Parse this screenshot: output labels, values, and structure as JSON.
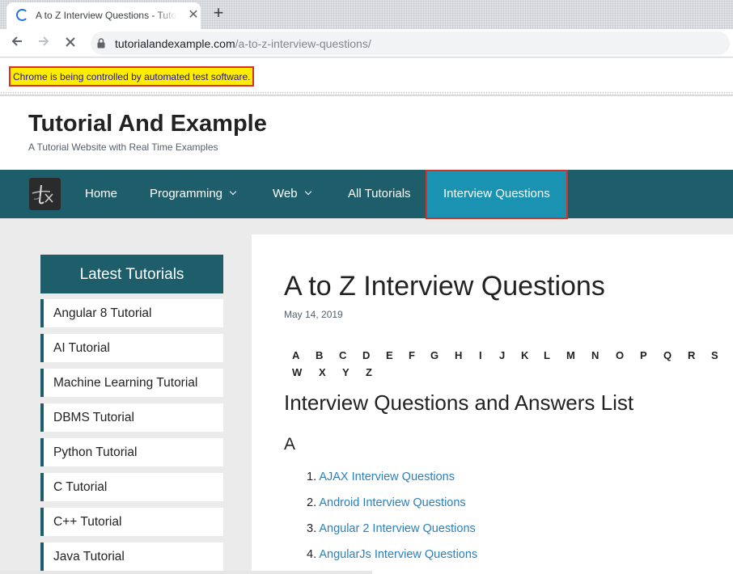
{
  "browser": {
    "tab_title": "A to Z Interview Questions - Tutorial And Example",
    "url_host": "tutorialandexample.com",
    "url_path": "/a-to-z-interview-questions/",
    "automation_notice": "Chrome is being controlled by automated test software."
  },
  "site": {
    "title": "Tutorial And Example",
    "tagline": "A Tutorial Website with Real Time Examples"
  },
  "nav": {
    "items": [
      {
        "label": "Home"
      },
      {
        "label": "Programming"
      },
      {
        "label": "Web"
      },
      {
        "label": "All Tutorials"
      },
      {
        "label": "Interview Questions"
      }
    ]
  },
  "sidebar": {
    "heading": "Latest Tutorials",
    "items": [
      {
        "label": "Angular 8 Tutorial"
      },
      {
        "label": "AI Tutorial"
      },
      {
        "label": "Machine Learning Tutorial"
      },
      {
        "label": "DBMS Tutorial"
      },
      {
        "label": "Python Tutorial"
      },
      {
        "label": "C Tutorial"
      },
      {
        "label": "C++ Tutorial"
      },
      {
        "label": "Java Tutorial"
      }
    ]
  },
  "article": {
    "title": "A to Z Interview Questions",
    "date": "May 14, 2019",
    "letters": [
      "A",
      "B",
      "C",
      "D",
      "E",
      "F",
      "G",
      "H",
      "I",
      "J",
      "K",
      "L",
      "M",
      "N",
      "O",
      "P",
      "Q",
      "R",
      "S",
      "W",
      "X",
      "Y",
      "Z"
    ],
    "section_title": "Interview Questions and Answers List",
    "section_letter": "A",
    "questions": [
      {
        "num": "1.",
        "label": "AJAX Interview Questions"
      },
      {
        "num": "2.",
        "label": "Android Interview Questions"
      },
      {
        "num": "3.",
        "label": "Angular 2 Interview Questions"
      },
      {
        "num": "4.",
        "label": "AngularJs Interview Questions"
      }
    ]
  },
  "colors": {
    "nav_bg": "#1e5d6a",
    "nav_active": "#1a93b2",
    "highlight_border": "#d93025",
    "link": "#2d7fb8",
    "automation_bg": "#ffed00"
  }
}
